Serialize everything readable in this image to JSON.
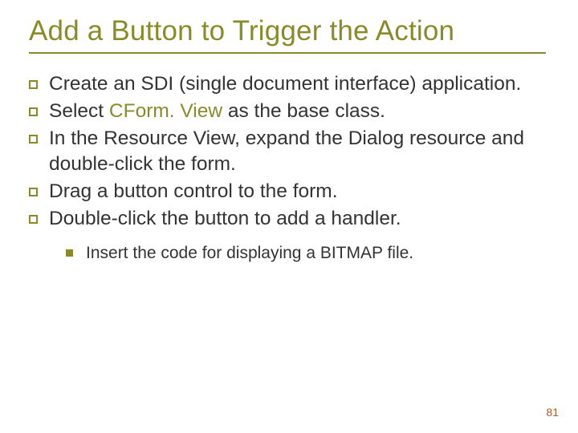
{
  "slide": {
    "title": "Add a Button to Trigger the Action",
    "bullets": [
      {
        "pre": "Create an SDI (single document interface) application.",
        "hl": "",
        "post": ""
      },
      {
        "pre": "Select ",
        "hl": "CForm. View",
        "post": " as the base class."
      },
      {
        "pre": "In the Resource View, expand the Dialog resource and double-click the form.",
        "hl": "",
        "post": ""
      },
      {
        "pre": "Drag a button control to the form.",
        "hl": "",
        "post": ""
      },
      {
        "pre": "Double-click the button to add a handler.",
        "hl": "",
        "post": ""
      }
    ],
    "sub_bullets": [
      {
        "text": "Insert the code for displaying a BITMAP file."
      }
    ],
    "page_number": "81"
  }
}
